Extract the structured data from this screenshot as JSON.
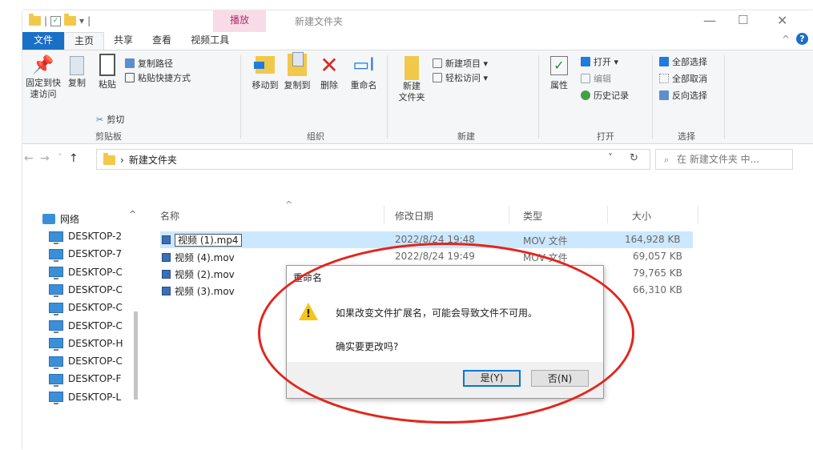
{
  "window": {
    "context_tab": "播放",
    "title": "新建文件夹",
    "controls": {
      "minimize": "—",
      "maximize": "☐",
      "close": "✕"
    }
  },
  "quick_access": {
    "sep": "|",
    "dropdown": "▾"
  },
  "ribbon_tabs": [
    "文件",
    "主页",
    "共享",
    "查看",
    "视频工具"
  ],
  "ribbon": {
    "clipboard": {
      "pin_label": "固定到快\n速访问",
      "copy_label": "复制",
      "paste_label": "粘贴",
      "copy_path": "复制路径",
      "paste_shortcut": "粘贴快捷方式",
      "cut": "剪切",
      "group": "剪贴板"
    },
    "organize": {
      "move_to": "移动到",
      "copy_to": "复制到",
      "delete": "删除",
      "rename": "重命名",
      "group": "组织"
    },
    "new": {
      "new_folder": "新建\n文件夹",
      "new_item": "新建项目 ▾",
      "easy_access": "轻松访问 ▾",
      "group": "新建"
    },
    "open": {
      "properties": "属性",
      "open": "打开 ▾",
      "edit": "编辑",
      "history": "历史记录",
      "group": "打开"
    },
    "select": {
      "select_all": "全部选择",
      "select_none": "全部取消",
      "invert": "反向选择",
      "group": "选择"
    }
  },
  "address": {
    "back": "←",
    "forward": "→",
    "recent": "˅",
    "up": "↑",
    "chevron": "›",
    "current_folder": "新建文件夹",
    "dropdown": "˅",
    "refresh": "↻",
    "search_placeholder": "在 新建文件夹 中..."
  },
  "nav_pane": {
    "network": "网络",
    "items": [
      "DESKTOP-2",
      "DESKTOP-7",
      "DESKTOP-C",
      "DESKTOP-C",
      "DESKTOP-C",
      "DESKTOP-C",
      "DESKTOP-H",
      "DESKTOP-C",
      "DESKTOP-F",
      "DESKTOP-L"
    ]
  },
  "columns": {
    "name": "名称",
    "date": "修改日期",
    "type": "类型",
    "size": "大小",
    "sort_arrow": "^"
  },
  "files": [
    {
      "name": "视频 (1).mp4",
      "date": "2022/8/24 19:48",
      "type": "MOV 文件",
      "size": "164,928 KB"
    },
    {
      "name": "视频 (4).mov",
      "date": "2022/8/24 19:49",
      "type": "MOV 文件",
      "size": "69,057 KB"
    },
    {
      "name": "视频 (2).mov",
      "date": "",
      "type": "",
      "size": "79,765 KB"
    },
    {
      "name": "视频 (3).mov",
      "date": "",
      "type": "",
      "size": "66,310 KB"
    }
  ],
  "dialog": {
    "title": "重命名",
    "message": "如果改变文件扩展名，可能会导致文件不可用。",
    "question": "确实要更改吗?",
    "yes": "是(Y)",
    "no": "否(N)"
  },
  "colors": {
    "accent": "#1a6fc7",
    "selection": "#cce8ff",
    "annotation": "#e3251c",
    "context_tab": "#f9dbe8"
  }
}
